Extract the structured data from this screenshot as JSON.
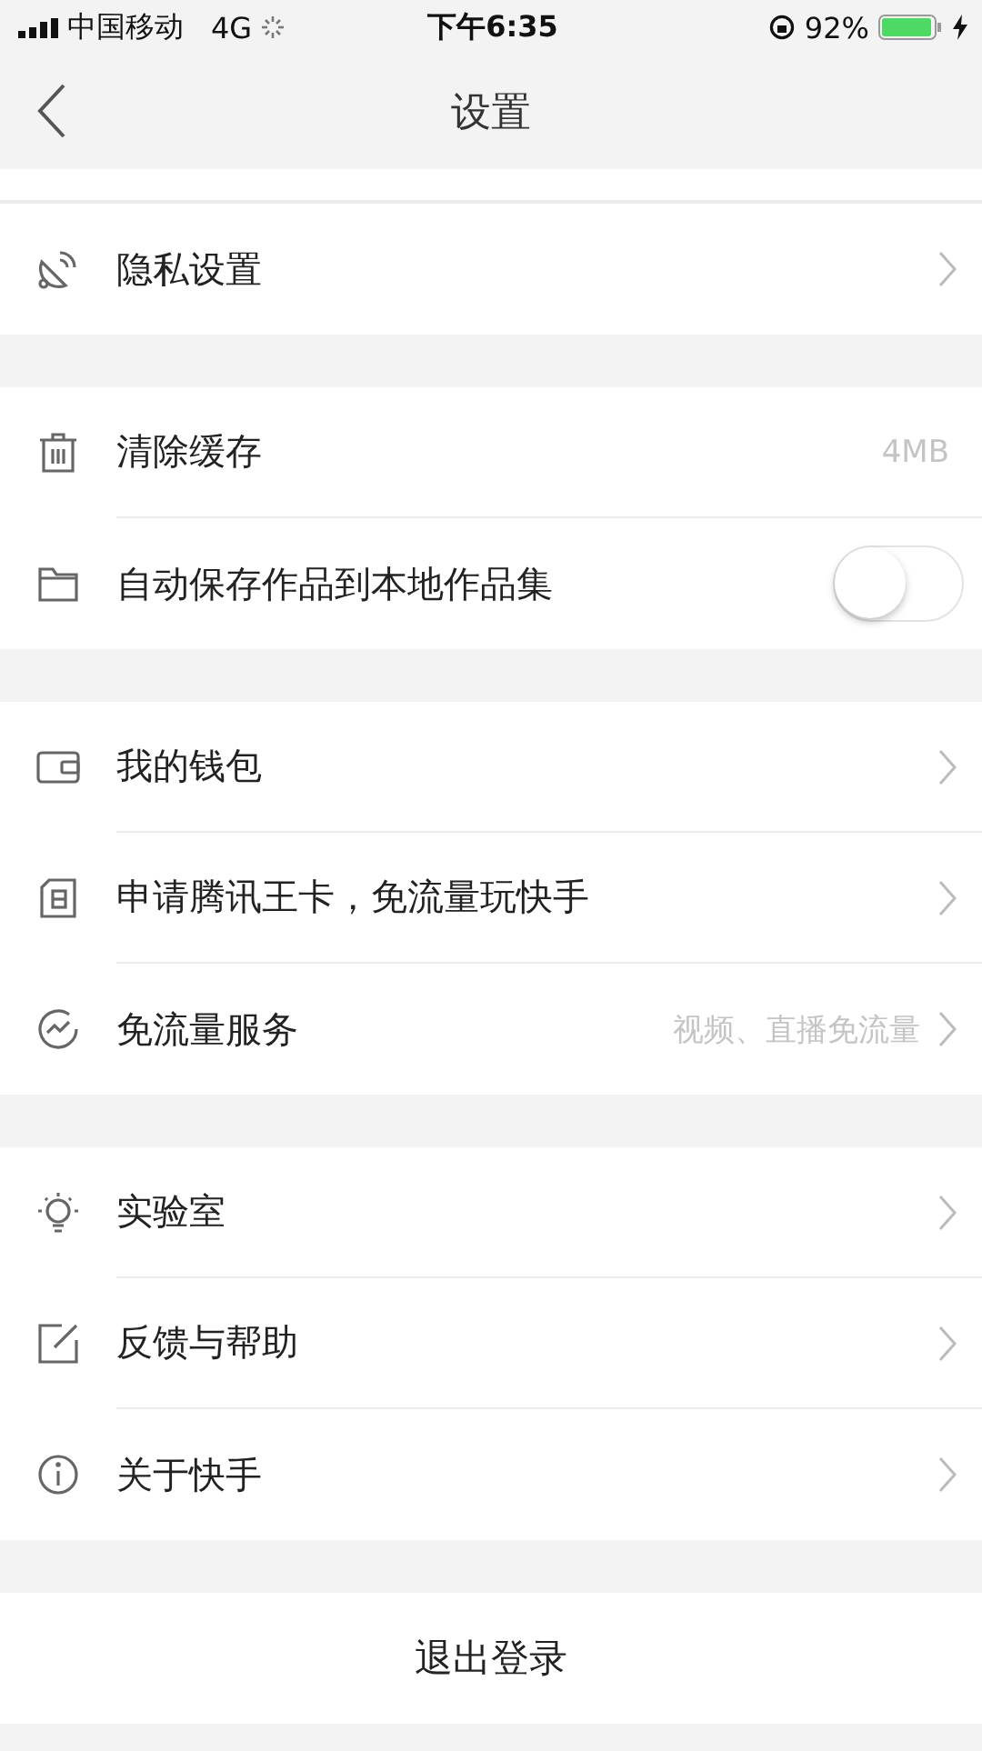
{
  "status_bar": {
    "carrier": "中国移动",
    "network": "4G",
    "time": "下午6:35",
    "battery": "92%"
  },
  "nav": {
    "title": "设置"
  },
  "sections": [
    {
      "rows": [
        {
          "kind": "link",
          "label": "隐私设置"
        }
      ]
    },
    {
      "rows": [
        {
          "kind": "value",
          "label": "清除缓存",
          "value": "4MB"
        },
        {
          "kind": "toggle",
          "label": "自动保存作品到本地作品集",
          "on": false
        }
      ]
    },
    {
      "rows": [
        {
          "kind": "link",
          "label": "我的钱包"
        },
        {
          "kind": "link",
          "label": "申请腾讯王卡，免流量玩快手"
        },
        {
          "kind": "link",
          "label": "免流量服务",
          "value": "视频、直播免流量"
        }
      ]
    },
    {
      "rows": [
        {
          "kind": "link",
          "label": "实验室"
        },
        {
          "kind": "link",
          "label": "反馈与帮助"
        },
        {
          "kind": "link",
          "label": "关于快手"
        }
      ]
    }
  ],
  "logout": "退出登录"
}
